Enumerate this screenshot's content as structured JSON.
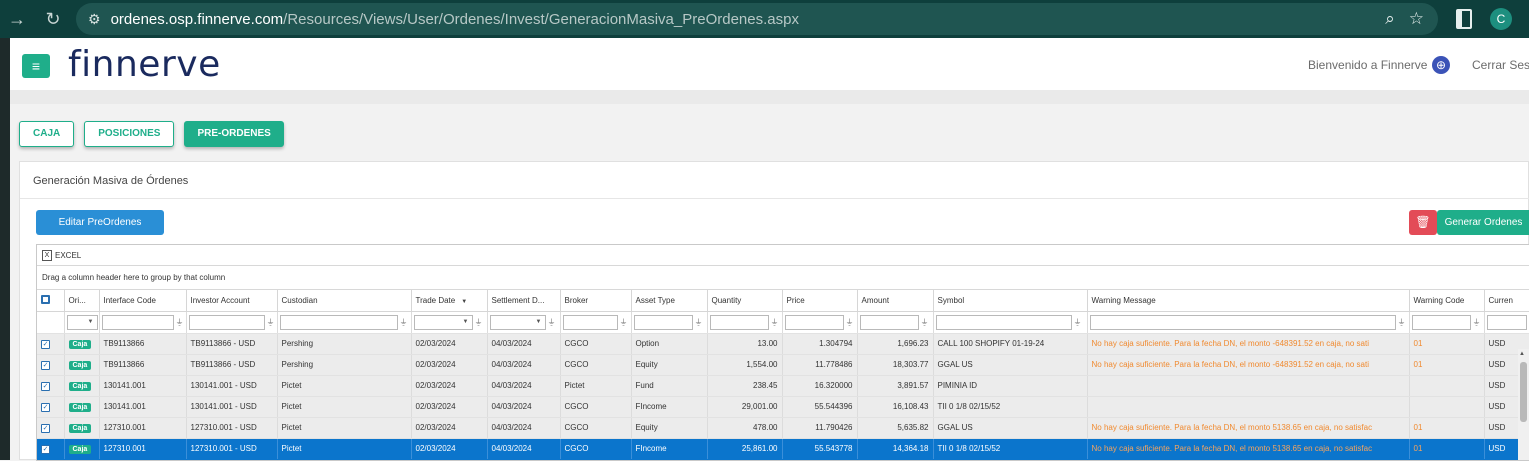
{
  "browser": {
    "url_host": "ordenes.osp.finnerve.com",
    "url_path": "/Resources/Views/User/Ordenes/Invest/GeneracionMasiva_PreOrdenes.aspx",
    "profile_initial": "C"
  },
  "header": {
    "logo": "finnerve",
    "welcome": "Bienvenido a Finnerve",
    "logout": "Cerrar Sesi"
  },
  "tabs": [
    {
      "label": "CAJA",
      "active": false
    },
    {
      "label": "POSICIONES",
      "active": false
    },
    {
      "label": "PRE-ORDENES",
      "active": true
    }
  ],
  "panel": {
    "title": "Generación Masiva de Órdenes",
    "edit_button": "Editar PreOrdenes",
    "generate_button": "Generar Ordenes"
  },
  "grid": {
    "toolbar_excel": "EXCEL",
    "group_hint": "Drag a column header here to group by that column",
    "columns": [
      "Ori...",
      "Interface Code",
      "Investor Account",
      "Custodian",
      "Trade Date",
      "Settlement D...",
      "Broker",
      "Asset Type",
      "Quantity",
      "Price",
      "Amount",
      "Symbol",
      "Warning Message",
      "Warning Code",
      "Curren"
    ],
    "rows": [
      {
        "origin": "Caja",
        "interface_code": "TB9113866",
        "investor_account": "TB9113866 - USD",
        "custodian": "Pershing",
        "trade_date": "02/03/2024",
        "settlement_date": "04/03/2024",
        "broker": "CGCO",
        "asset_type": "Option",
        "quantity": "13.00",
        "price": "1.304794",
        "amount": "1,696.23",
        "symbol": "CALL 100 SHOPIFY 01-19-24",
        "warning_message": "No hay caja suficiente. Para la fecha DN, el monto -648391.52 en caja, no sati",
        "warning_code": "01",
        "currency": "USD",
        "selected": false
      },
      {
        "origin": "Caja",
        "interface_code": "TB9113866",
        "investor_account": "TB9113866 - USD",
        "custodian": "Pershing",
        "trade_date": "02/03/2024",
        "settlement_date": "04/03/2024",
        "broker": "CGCO",
        "asset_type": "Equity",
        "quantity": "1,554.00",
        "price": "11.778486",
        "amount": "18,303.77",
        "symbol": "GGAL US",
        "warning_message": "No hay caja suficiente. Para la fecha DN, el monto -648391.52 en caja, no sati",
        "warning_code": "01",
        "currency": "USD",
        "selected": false
      },
      {
        "origin": "Caja",
        "interface_code": "130141.001",
        "investor_account": "130141.001 - USD",
        "custodian": "Pictet",
        "trade_date": "02/03/2024",
        "settlement_date": "04/03/2024",
        "broker": "Pictet",
        "asset_type": "Fund",
        "quantity": "238.45",
        "price": "16.320000",
        "amount": "3,891.57",
        "symbol": "PIMINIA ID",
        "warning_message": "",
        "warning_code": "",
        "currency": "USD",
        "selected": false
      },
      {
        "origin": "Caja",
        "interface_code": "130141.001",
        "investor_account": "130141.001 - USD",
        "custodian": "Pictet",
        "trade_date": "02/03/2024",
        "settlement_date": "04/03/2024",
        "broker": "CGCO",
        "asset_type": "FIncome",
        "quantity": "29,001.00",
        "price": "55.544396",
        "amount": "16,108.43",
        "symbol": "TII 0 1/8 02/15/52",
        "warning_message": "",
        "warning_code": "",
        "currency": "USD",
        "selected": false
      },
      {
        "origin": "Caja",
        "interface_code": "127310.001",
        "investor_account": "127310.001 - USD",
        "custodian": "Pictet",
        "trade_date": "02/03/2024",
        "settlement_date": "04/03/2024",
        "broker": "CGCO",
        "asset_type": "Equity",
        "quantity": "478.00",
        "price": "11.790426",
        "amount": "5,635.82",
        "symbol": "GGAL US",
        "warning_message": "No hay caja suficiente. Para la fecha DN, el monto 5138.65 en caja, no satisfac",
        "warning_code": "01",
        "currency": "USD",
        "selected": false
      },
      {
        "origin": "Caja",
        "interface_code": "127310.001",
        "investor_account": "127310.001 - USD",
        "custodian": "Pictet",
        "trade_date": "02/03/2024",
        "settlement_date": "04/03/2024",
        "broker": "CGCO",
        "asset_type": "FIncome",
        "quantity": "25,861.00",
        "price": "55.543778",
        "amount": "14,364.18",
        "symbol": "TII 0 1/8 02/15/52",
        "warning_message": "No hay caja suficiente. Para la fecha DN, el monto 5138.65 en caja, no satisfac",
        "warning_code": "01",
        "currency": "USD",
        "selected": true
      }
    ]
  },
  "colors": {
    "accent": "#1fae8a",
    "primary_blue": "#2a8fd6",
    "danger": "#e34b57",
    "selected_row": "#0b75cc",
    "warning_text": "#f08a30"
  }
}
